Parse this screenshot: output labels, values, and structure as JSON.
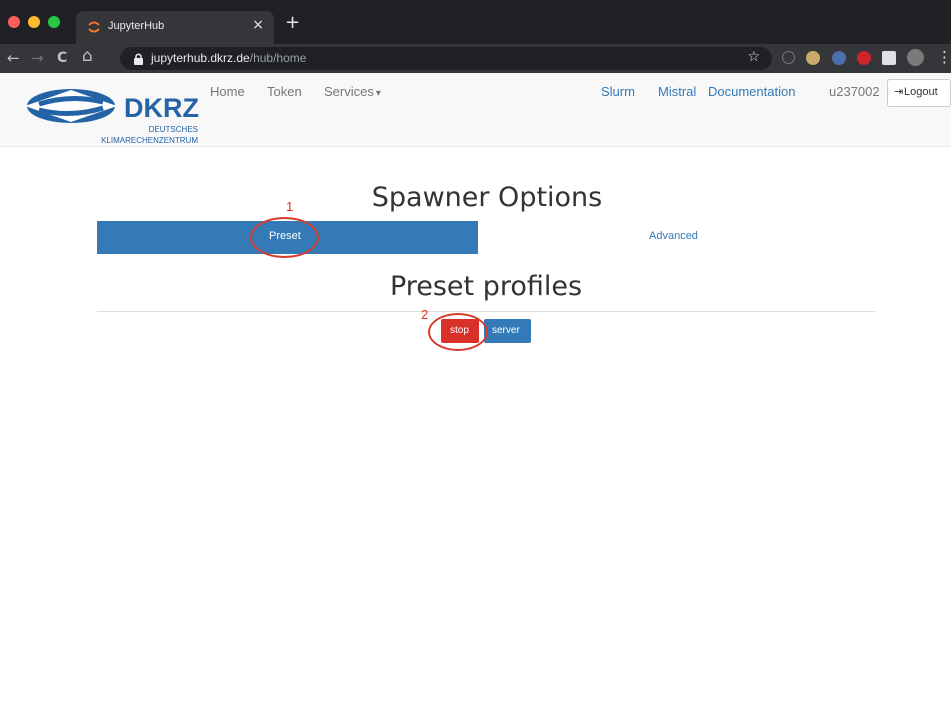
{
  "browser": {
    "tab_title": "JupyterHub",
    "tab_close": "×",
    "new_tab": "+",
    "url_host": "jupyterhub.dkrz.de",
    "url_path": "/hub/home",
    "back_icon": "←",
    "forward_icon": "→",
    "reload_icon": "C",
    "home_icon": "⌂",
    "star_icon": "☆",
    "menu_icon": "⋮"
  },
  "navbar": {
    "logo_main": "DKRZ",
    "logo_sub1": "DEUTSCHES",
    "logo_sub2": "KLIMARECHENZENTRUM",
    "links": [
      "Home",
      "Token",
      "Services"
    ],
    "services_caret": "▾",
    "right_links": [
      "Slurm",
      "Mistral",
      "Documentation"
    ],
    "user": "u237002",
    "logout": "Logout",
    "logout_icon": "⇥"
  },
  "main": {
    "title": "Spawner Options",
    "tabs": [
      "Preset",
      "Advanced"
    ],
    "section_title": "Preset profiles",
    "buttons": {
      "stop": "stop",
      "server": "server"
    }
  },
  "annotations": [
    "1",
    "2"
  ],
  "colors": {
    "primary": "#337ab7",
    "danger": "#d9302a",
    "annotation": "#d93a2c"
  }
}
